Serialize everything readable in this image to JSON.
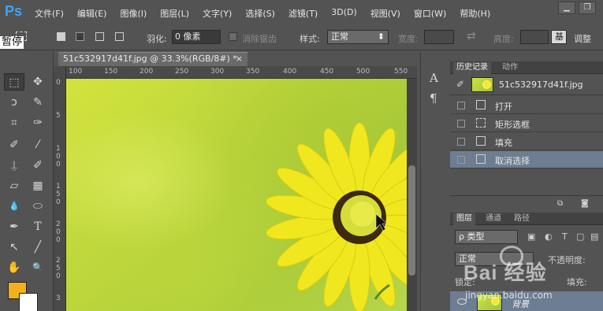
{
  "app": {
    "logo": "Ps"
  },
  "menu": [
    "文件(F)",
    "编辑(E)",
    "图像(I)",
    "图层(L)",
    "文字(Y)",
    "选择(S)",
    "滤镜(T)",
    "3D(D)",
    "视图(V)",
    "窗口(W)",
    "帮助(H)"
  ],
  "window_controls": {
    "minimize": "▁",
    "restore": "❐"
  },
  "overlay": {
    "pause": "暂停"
  },
  "options": {
    "feather_label": "羽化:",
    "feather_value": "0 像素",
    "antialias_label": "消除锯齿",
    "style_label": "样式:",
    "style_value": "正常",
    "width_label": "宽度:",
    "height_label": "高度:",
    "swap_icon": "⇄",
    "adjust_button": "基",
    "adjust_label": "调整"
  },
  "document": {
    "tab_title": "51c532917d41f.jpg @ 33.3%(RGB/8#) *",
    "close": "×",
    "ruler_h": [
      "100",
      "150",
      "200",
      "250",
      "300",
      "350",
      "400",
      "450",
      "500",
      "550"
    ],
    "ruler_v_groups": [
      [
        "0"
      ],
      [
        "5"
      ],
      [
        "1",
        "0",
        "0"
      ],
      [
        "1",
        "5",
        "0"
      ],
      [
        "2",
        "0",
        "0"
      ],
      [
        "2",
        "5",
        "0"
      ],
      [
        "3"
      ]
    ]
  },
  "tools": {
    "icons": [
      "marquee-tool",
      "move-tool",
      "lasso-tool",
      "quick-select-tool",
      "crop-tool",
      "eyedropper-tool",
      "healing-tool",
      "brush-tool",
      "stamp-tool",
      "history-brush-tool",
      "eraser-tool",
      "gradient-tool",
      "blur-tool",
      "dodge-tool",
      "pen-tool",
      "type-tool",
      "path-select-tool",
      "line-tool",
      "hand-tool",
      "zoom-tool"
    ],
    "glyphs": [
      "⬚",
      "✥",
      "ↄ",
      "✎",
      "⌗",
      "✑",
      "✐",
      "⁄",
      "⍊",
      "✐",
      "▱",
      "▦",
      "💧",
      "⬭",
      "✒",
      "T",
      "↖",
      "╱",
      "✋",
      "🔍"
    ],
    "foreground_color": "#f4b01c",
    "background_color": "#ffffff"
  },
  "mini_panel": {
    "char_icon": "A",
    "para_icon": "¶"
  },
  "history_panel": {
    "tabs": [
      "历史记录",
      "动作"
    ],
    "snapshot": "51c532917d41f.jpg",
    "items": [
      {
        "label": "打开",
        "selected": false
      },
      {
        "label": "矩形选框",
        "selected": false
      },
      {
        "label": "填充",
        "selected": false
      },
      {
        "label": "取消选择",
        "selected": true
      }
    ]
  },
  "layers_panel": {
    "tabs": [
      "图层",
      "通道",
      "路径"
    ],
    "filter": "ρ 类型",
    "blend_mode": "正常",
    "opacity_label": "不透明度:",
    "lock_label": "锁定:",
    "fill_label": "填充:",
    "layer_name": "背景"
  },
  "watermark": {
    "text": "Bai 经验",
    "url": "jingyan.baidu.com"
  }
}
